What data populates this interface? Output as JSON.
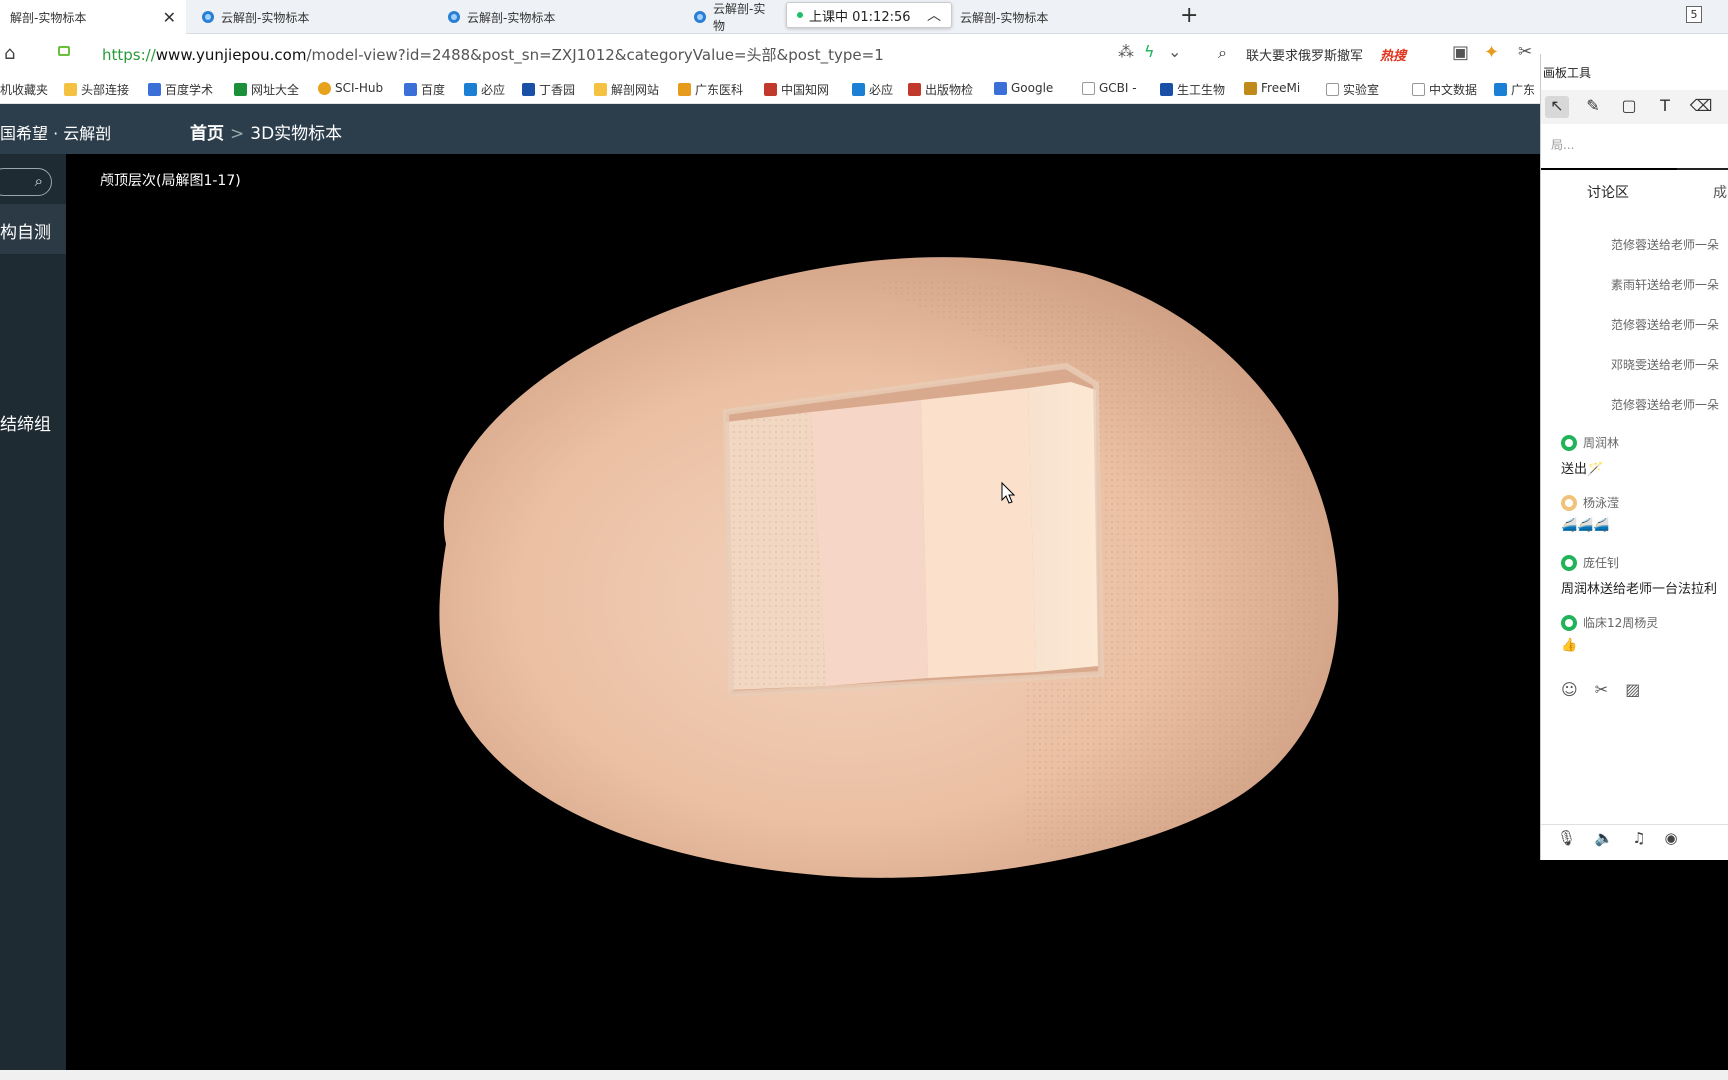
{
  "browser": {
    "tabs": [
      {
        "label": "解剖-实物标本"
      },
      {
        "label": "云解剖-实物标本"
      },
      {
        "label": "云解剖-实物标本"
      },
      {
        "label": "云解剖-实物"
      },
      {
        "label": "云解剖-实物标本"
      }
    ],
    "tab_count": "5",
    "new_tab": "+",
    "status_pill": "上课中 01:12:56",
    "url_proto": "https://",
    "url_host": "www.yunjiepou.com",
    "url_path": "/model-view?id=2488&post_sn=ZXJ1012&categoryValue=头部&post_type=1",
    "search_text": "联大要求俄罗斯撤军",
    "hot_label": "热搜"
  },
  "bookmarks": [
    {
      "label": "机收藏夹",
      "color": "#f4c142"
    },
    {
      "label": "头部连接",
      "color": "#f4c142"
    },
    {
      "label": "百度学术",
      "color": "#3a6fd8"
    },
    {
      "label": "网址大全",
      "color": "#1b8f3a"
    },
    {
      "label": "SCI-Hub",
      "color": "#e6a21b"
    },
    {
      "label": "百度",
      "color": "#3a6fd8"
    },
    {
      "label": "必应",
      "color": "#1b7fd4"
    },
    {
      "label": "丁香园",
      "color": "#1a4fa8"
    },
    {
      "label": "解剖网站",
      "color": "#f4c142"
    },
    {
      "label": "广东医科",
      "color": "#e69b1b"
    },
    {
      "label": "中国知网",
      "color": "#c0392b"
    },
    {
      "label": "必应",
      "color": "#1b7fd4"
    },
    {
      "label": "出版物检",
      "color": "#c0392b"
    },
    {
      "label": "Google",
      "color": "#3a6fd8"
    },
    {
      "label": "GCBI -",
      "color": "#999999"
    },
    {
      "label": "生工生物",
      "color": "#1a4fa8"
    },
    {
      "label": "FreeMi",
      "color": "#c08a1b"
    },
    {
      "label": "实验室",
      "color": "#999999"
    },
    {
      "label": "中文数据",
      "color": "#999999"
    },
    {
      "label": "广东",
      "color": "#1b7fd4"
    }
  ],
  "site": {
    "brand": "国希望 · 云解剖",
    "crumb_home": "首页",
    "crumb_sep": ">",
    "crumb_current": "3D实物标本"
  },
  "left_panel": {
    "items": [
      {
        "label": "构自测"
      },
      {
        "label": "结缔组"
      }
    ]
  },
  "viewer": {
    "title": "颅顶层次(局解图1-17)"
  },
  "right_panel": {
    "tool_title": "画板工具",
    "input_placeholder": "局...",
    "tab_discussion": "讨论区",
    "tab_other": "成",
    "gifts": [
      "范修蓉送给老师一朵",
      "素雨轩送给老师一朵",
      "范修蓉送给老师一朵",
      "邓晓雯送给老师一朵",
      "范修蓉送给老师一朵"
    ],
    "messages": [
      {
        "user": "周润林",
        "text": "送出🪄"
      },
      {
        "user": "杨泳滢",
        "text": "🚄🚄🚄"
      },
      {
        "user": "庞任钊",
        "text": "周润林送给老师一台法拉利"
      },
      {
        "user": "临床12周杨灵",
        "text": "👍"
      }
    ]
  }
}
